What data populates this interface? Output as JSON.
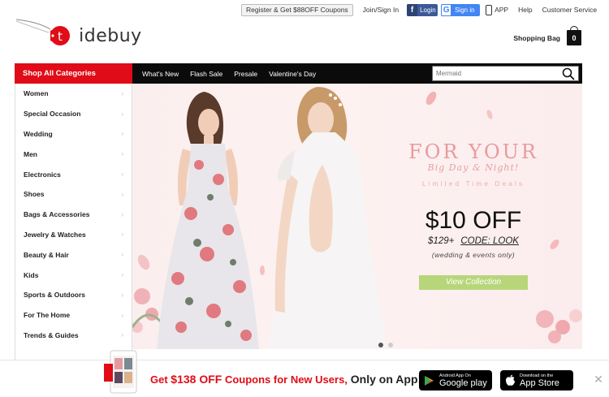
{
  "topbar": {
    "coupon_label": "Register & Get $88OFF Coupons",
    "join_signin": "Join/Sign In",
    "facebook_login": "Login",
    "google_signin": "Sign in",
    "app_label": "APP",
    "help_label": "Help",
    "customer_service_label": "Customer Service"
  },
  "logo": {
    "text": "tidebuy",
    "brand_color": "#e00c17"
  },
  "cart": {
    "label": "Shopping Bag",
    "count": "0"
  },
  "nav": {
    "shop_all": "Shop All Categories",
    "items": [
      "What's New",
      "Flash Sale",
      "Presale",
      "Valentine's Day"
    ]
  },
  "search": {
    "placeholder": "Mermaid"
  },
  "sidebar": {
    "items": [
      "Women",
      "Special Occasion",
      "Wedding",
      "Men",
      "Electronics",
      "Shoes",
      "Bags & Accessories",
      "Jewelry & Watches",
      "Beauty & Hair",
      "Kids",
      "Sports & Outdoors",
      "For The Home",
      "Trends & Guides"
    ]
  },
  "banner": {
    "headline": "FOR YOUR",
    "subline": "Big Day & Night!",
    "limited": "Limited Time Deals",
    "offer": "$10 OFF",
    "min_spend": "$129+",
    "code": "CODE: LOOK",
    "note": "(wedding & events only)",
    "cta": "View Collection",
    "slides": 2,
    "active_slide": 1
  },
  "promo": {
    "prefix": "Get ",
    "amount": "$138 OFF",
    "mid": " Coupons for New Users,",
    "suffix": " Only on App!",
    "google_small": "Android App On",
    "google_large": "Google play",
    "apple_small": "Download on the",
    "apple_large": "App Store"
  },
  "colors": {
    "accent_red": "#e00c17",
    "nav_black": "#0b0b0b",
    "cta_green": "#b7d67a",
    "headline_pink": "#e89a9e"
  }
}
